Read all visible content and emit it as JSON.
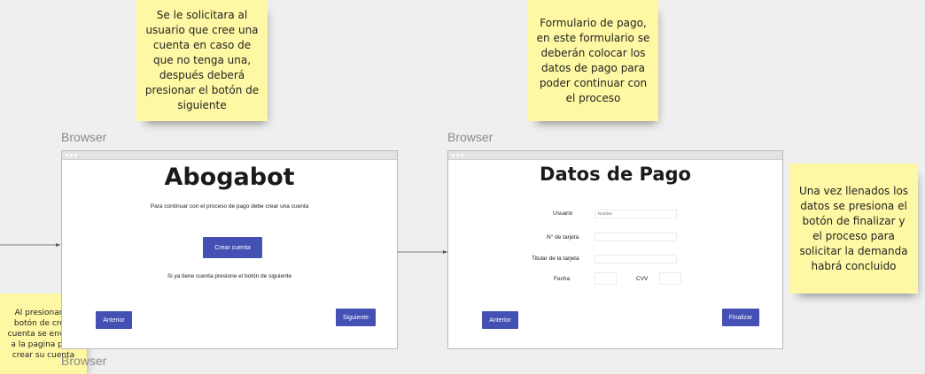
{
  "stickies": {
    "note1": "Se le solicitara al usuario que cree una cuenta en caso de que no tenga una, después deberá presionar el botón de siguiente",
    "note2": "Formulario de pago, en este formulario se deberán colocar los datos de pago para poder continuar con el proceso",
    "note3": "Una vez llenados los datos se presiona el botón de finalizar y el proceso para solicitar la demanda habrá concluido",
    "note4": "Al presionar el botón de crear cuenta se enviara a la pagina para crear su cuenta"
  },
  "browser_label": "Browser",
  "frame1": {
    "title": "Abogabot",
    "subtitle": "Para continuar con el proceso de pago debe crear una cuenta",
    "create_account": "Crear cuenta",
    "have_account": "Si ya tiene cuenta presione el botón de siguiente",
    "prev": "Anterior",
    "next": "Siguiente"
  },
  "frame2": {
    "title": "Datos de Pago",
    "usuario_label": "Usuario",
    "usuario_value": "Nombre",
    "card_number_label": "N° de tarjeta",
    "holder_label": "Titular de la tarjeta",
    "date_label": "Fecha",
    "cvv_label": "CVV",
    "prev": "Anterior",
    "finish": "Finalizar"
  },
  "colors": {
    "sticky": "#fef8a4",
    "button": "#4450b4",
    "canvas": "#efefef"
  }
}
